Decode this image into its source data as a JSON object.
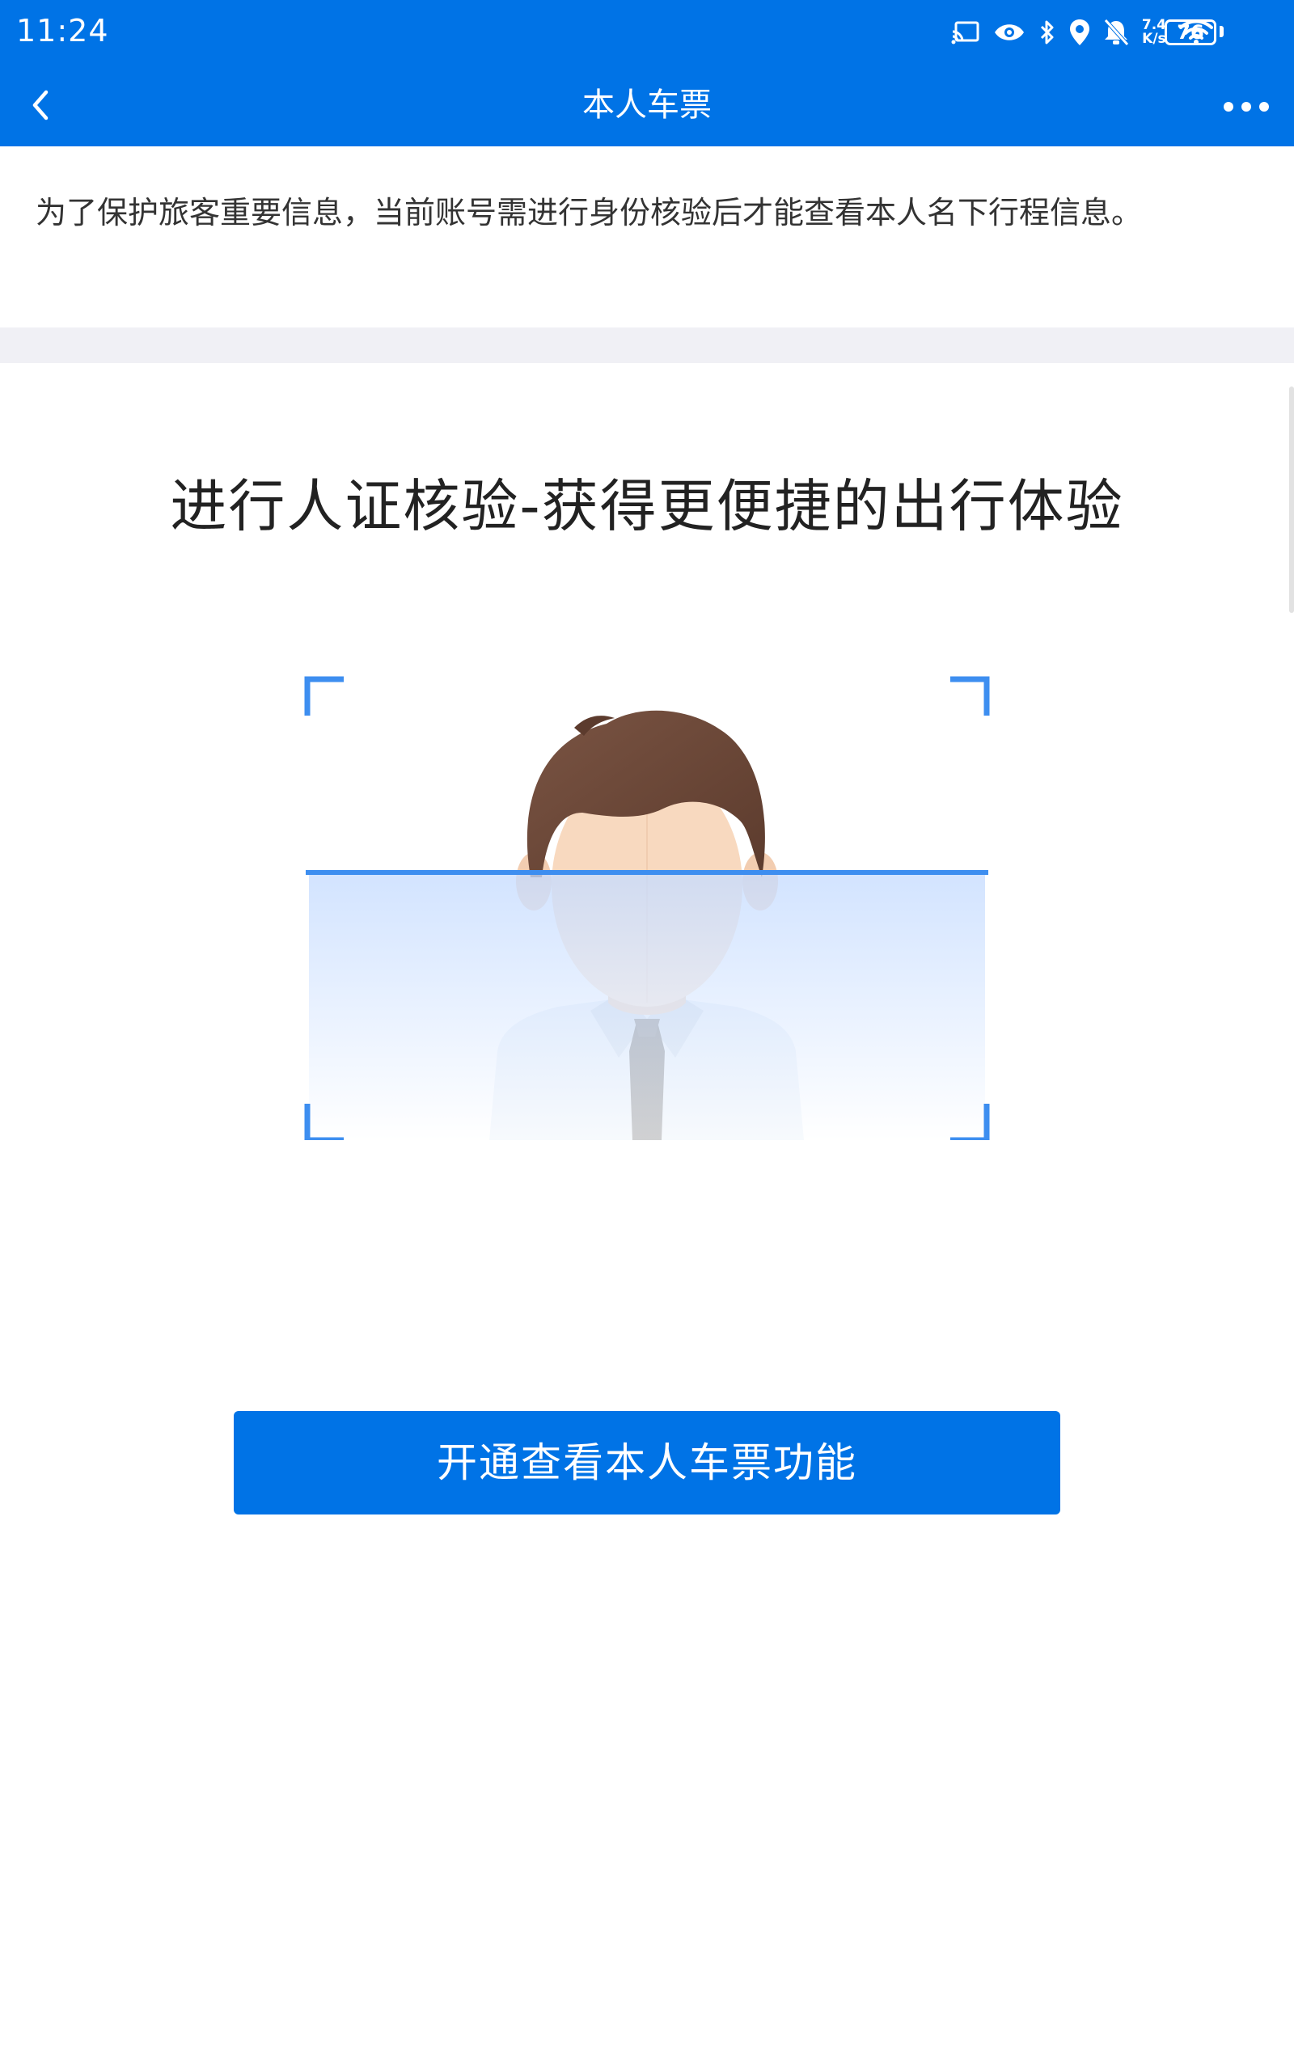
{
  "status_bar": {
    "time": "11:24",
    "net_speed_value": "7.4",
    "net_speed_unit": "K/s",
    "battery": "76",
    "icons": [
      "cast-icon",
      "eye-icon",
      "bluetooth-icon",
      "location-icon",
      "mute-icon",
      "wifi-icon",
      "battery-icon"
    ]
  },
  "nav": {
    "title": "本人车票",
    "back_icon": "chevron-left-icon",
    "more_icon": "more-icon"
  },
  "notice": {
    "text": "为了保护旅客重要信息，当前账号需进行身份核验后才能查看本人名下行程信息。"
  },
  "main": {
    "headline": "进行人证核验-获得更便捷的出行体验",
    "illustration": "face-scan-illustration",
    "button_label": "开通查看本人车票功能"
  },
  "colors": {
    "primary": "#0073e6",
    "scan_line": "#3d8ef0",
    "divider": "#f0f0f5",
    "text_dark": "#222222",
    "text_body": "#333333"
  }
}
